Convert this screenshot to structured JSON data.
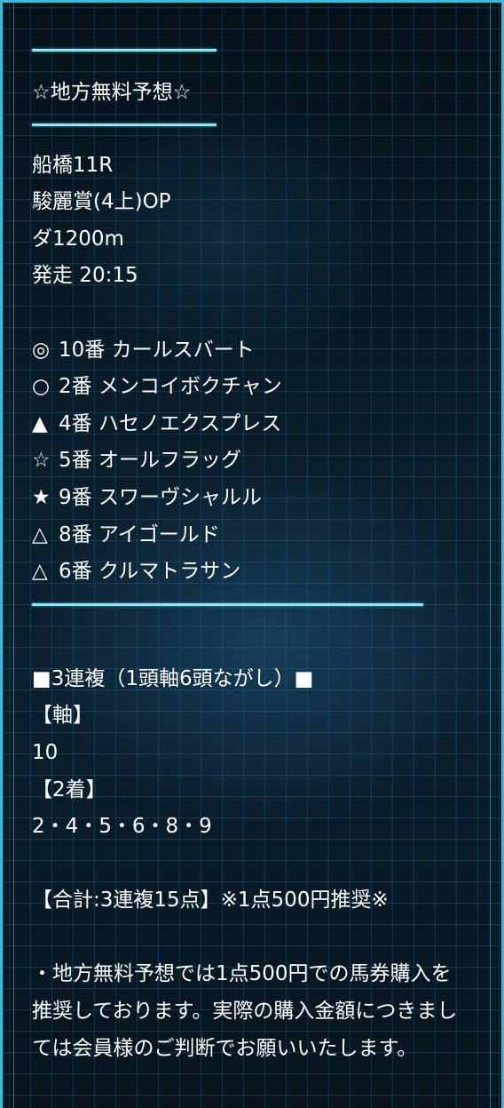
{
  "header": {
    "title": "☆地方無料予想☆"
  },
  "race": {
    "venue_race": "船橋11R",
    "name": "駿麗賞(4上)OP",
    "course": "ダ1200m",
    "start_time": "発走 20:15"
  },
  "picks": [
    {
      "mark": "◎",
      "text": "10番 カールスバート"
    },
    {
      "mark": "○",
      "text": "2番 メンコイボクチャン"
    },
    {
      "mark": "▲",
      "text": "4番 ハセノエクスプレス"
    },
    {
      "mark": "☆",
      "text": "5番 オールフラッグ"
    },
    {
      "mark": "★",
      "text": "9番 スワーヴシャルル"
    },
    {
      "mark": "△",
      "text": "8番 アイゴールド"
    },
    {
      "mark": "△",
      "text": "6番 クルマトラサン"
    }
  ],
  "bet": {
    "heading": "■3連複（1頭軸6頭ながし）■",
    "axis_label": "【軸】",
    "axis_value": "10",
    "second_label": "【2着】",
    "second_value": "2・4・5・6・8・9",
    "total": "【合計:3連複15点】※1点500円推奨※"
  },
  "note": "・地方無料予想では1点500円での馬券購入を推奨しております。実際の購入金額につきましては会員様のご判断でお願いいたします。"
}
